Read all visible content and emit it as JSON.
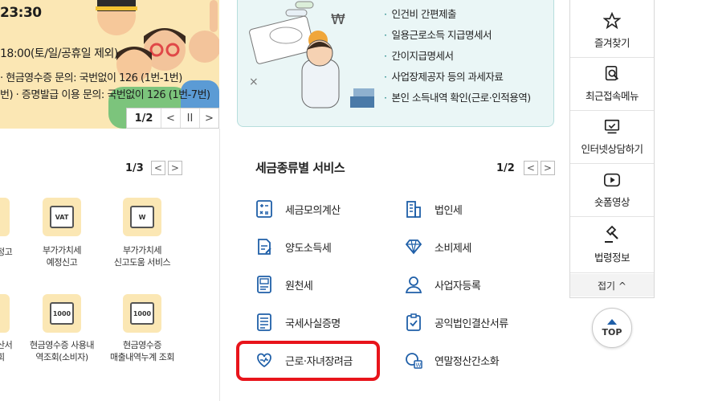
{
  "banner": {
    "time": "23:30",
    "hours": "18:00(토/일/공휴일 제외)",
    "cash_receipt_inquiry": "· 현금영수증 문의: 국번없이 126 (1번-1번)",
    "cert_inquiry": "번) · 증명발급 이용 문의: 국번없이 126 (1번-7번)",
    "pager": {
      "current": "1/2",
      "prev": "<",
      "pause": "II",
      "next": ">"
    }
  },
  "left_panel": {
    "pager": {
      "current": "1/3",
      "prev": "<",
      "next": ">"
    },
    "tiles": [
      {
        "label": "정고",
        "icon": "partial-icon"
      },
      {
        "label": "부가가치세\n예정신고",
        "icon": "vat-document-icon",
        "icon_text": "VAT"
      },
      {
        "label": "부가가치세\n신고도움 서비스",
        "icon": "vat-search-icon",
        "icon_text": "W"
      },
      {
        "label": "산서\n회",
        "icon": "partial-icon"
      },
      {
        "label": "현금영수증 사용내\n역조회(소비자)",
        "icon": "cash-receipt-icon",
        "icon_text": "1000"
      },
      {
        "label": "현금영수증\n매출내역누계 조회",
        "icon": "cash-receipt-sales-icon",
        "icon_text": "1000"
      }
    ]
  },
  "center_card": {
    "bullets": [
      "인건비 간편제출",
      "일용근로소득 지급명세서",
      "간이지급명세서",
      "사업장제공자 등의 과세자료",
      "본인 소득내역 확인(근로·인적용역)"
    ]
  },
  "tax_services": {
    "title": "세금종류별 서비스",
    "pager": {
      "current": "1/2",
      "prev": "<",
      "next": ">"
    },
    "items_left": [
      "세금모의계산",
      "양도소득세",
      "원천세",
      "국세사실증명",
      "근로·자녀장려금"
    ],
    "items_right": [
      "법인세",
      "소비제세",
      "사업자등록",
      "공익법인결산서류",
      "연말정산간소화"
    ]
  },
  "quick_menu": {
    "items": [
      "즐겨찾기",
      "최근접속메뉴",
      "인터넷상담하기",
      "숏폼영상",
      "법령정보"
    ],
    "fold": "접기 ^",
    "top": "TOP"
  },
  "colors": {
    "accent": "#1f5fa8",
    "highlight": "#e8141b",
    "tile_bg": "#fbe7b4",
    "card_bg": "#eaf6f6"
  }
}
